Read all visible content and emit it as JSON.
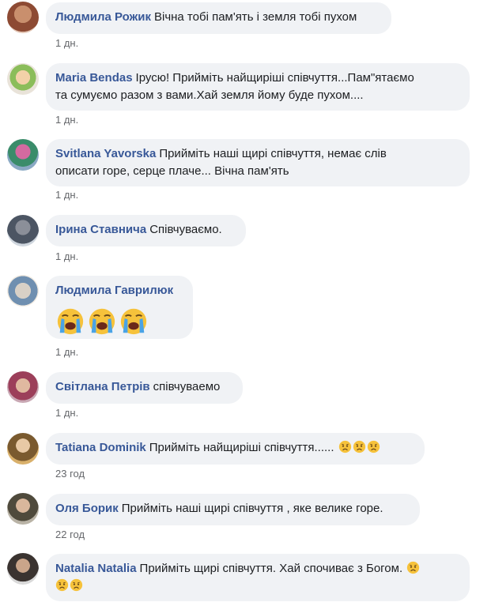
{
  "comments": [
    {
      "name": "Людмила Рожик",
      "text": "Вічна тобі пам'ять і земля тобі пухом",
      "time": "1 дн."
    },
    {
      "name": "Maria Bendas",
      "text": "Ірусю! Прийміть найщиріші співчуття...Пам\"ятаємо",
      "text2": "та сумуємо разом з вами.Хай земля йому буде пухом....",
      "time": "1 дн."
    },
    {
      "name": "Svitlana Yavorska",
      "text": "Прийміть наші щирі співчуття, немає слів",
      "text2": "описати горе, серце плаче... Вічна пам'ять",
      "time": "1 дн."
    },
    {
      "name": "Ірина Ставнича",
      "text": "Співчуваємо.",
      "time": "1 дн."
    },
    {
      "name": "Людмила Гаврилюк",
      "emoji": [
        "crying-face",
        "crying-face",
        "crying-face"
      ],
      "time": "1 дн."
    },
    {
      "name": "Світлана Петрів",
      "text": "співчуваемо",
      "time": "1 дн."
    },
    {
      "name": "Tatiana Dominik",
      "text": "Прийміть найщиріші співчуття......",
      "emoji": [
        "sad-face",
        "sad-face",
        "sad-face"
      ],
      "time": "23 год"
    },
    {
      "name": "Оля Борик",
      "text": "Прийміть наші щирі співчуття , яке велике горе.",
      "time": "22 год"
    },
    {
      "name": "Natalia Natalia",
      "text": "Прийміть щирі співчуття. Хай спочиває з Богом.",
      "emoji": [
        "sad-face"
      ],
      "emoji2": [
        "sad-face",
        "sad-face"
      ],
      "time": ""
    }
  ],
  "colors": {
    "name": "#385898",
    "bubble": "#f0f2f5",
    "time": "#65676b",
    "text": "#1c1e21"
  }
}
